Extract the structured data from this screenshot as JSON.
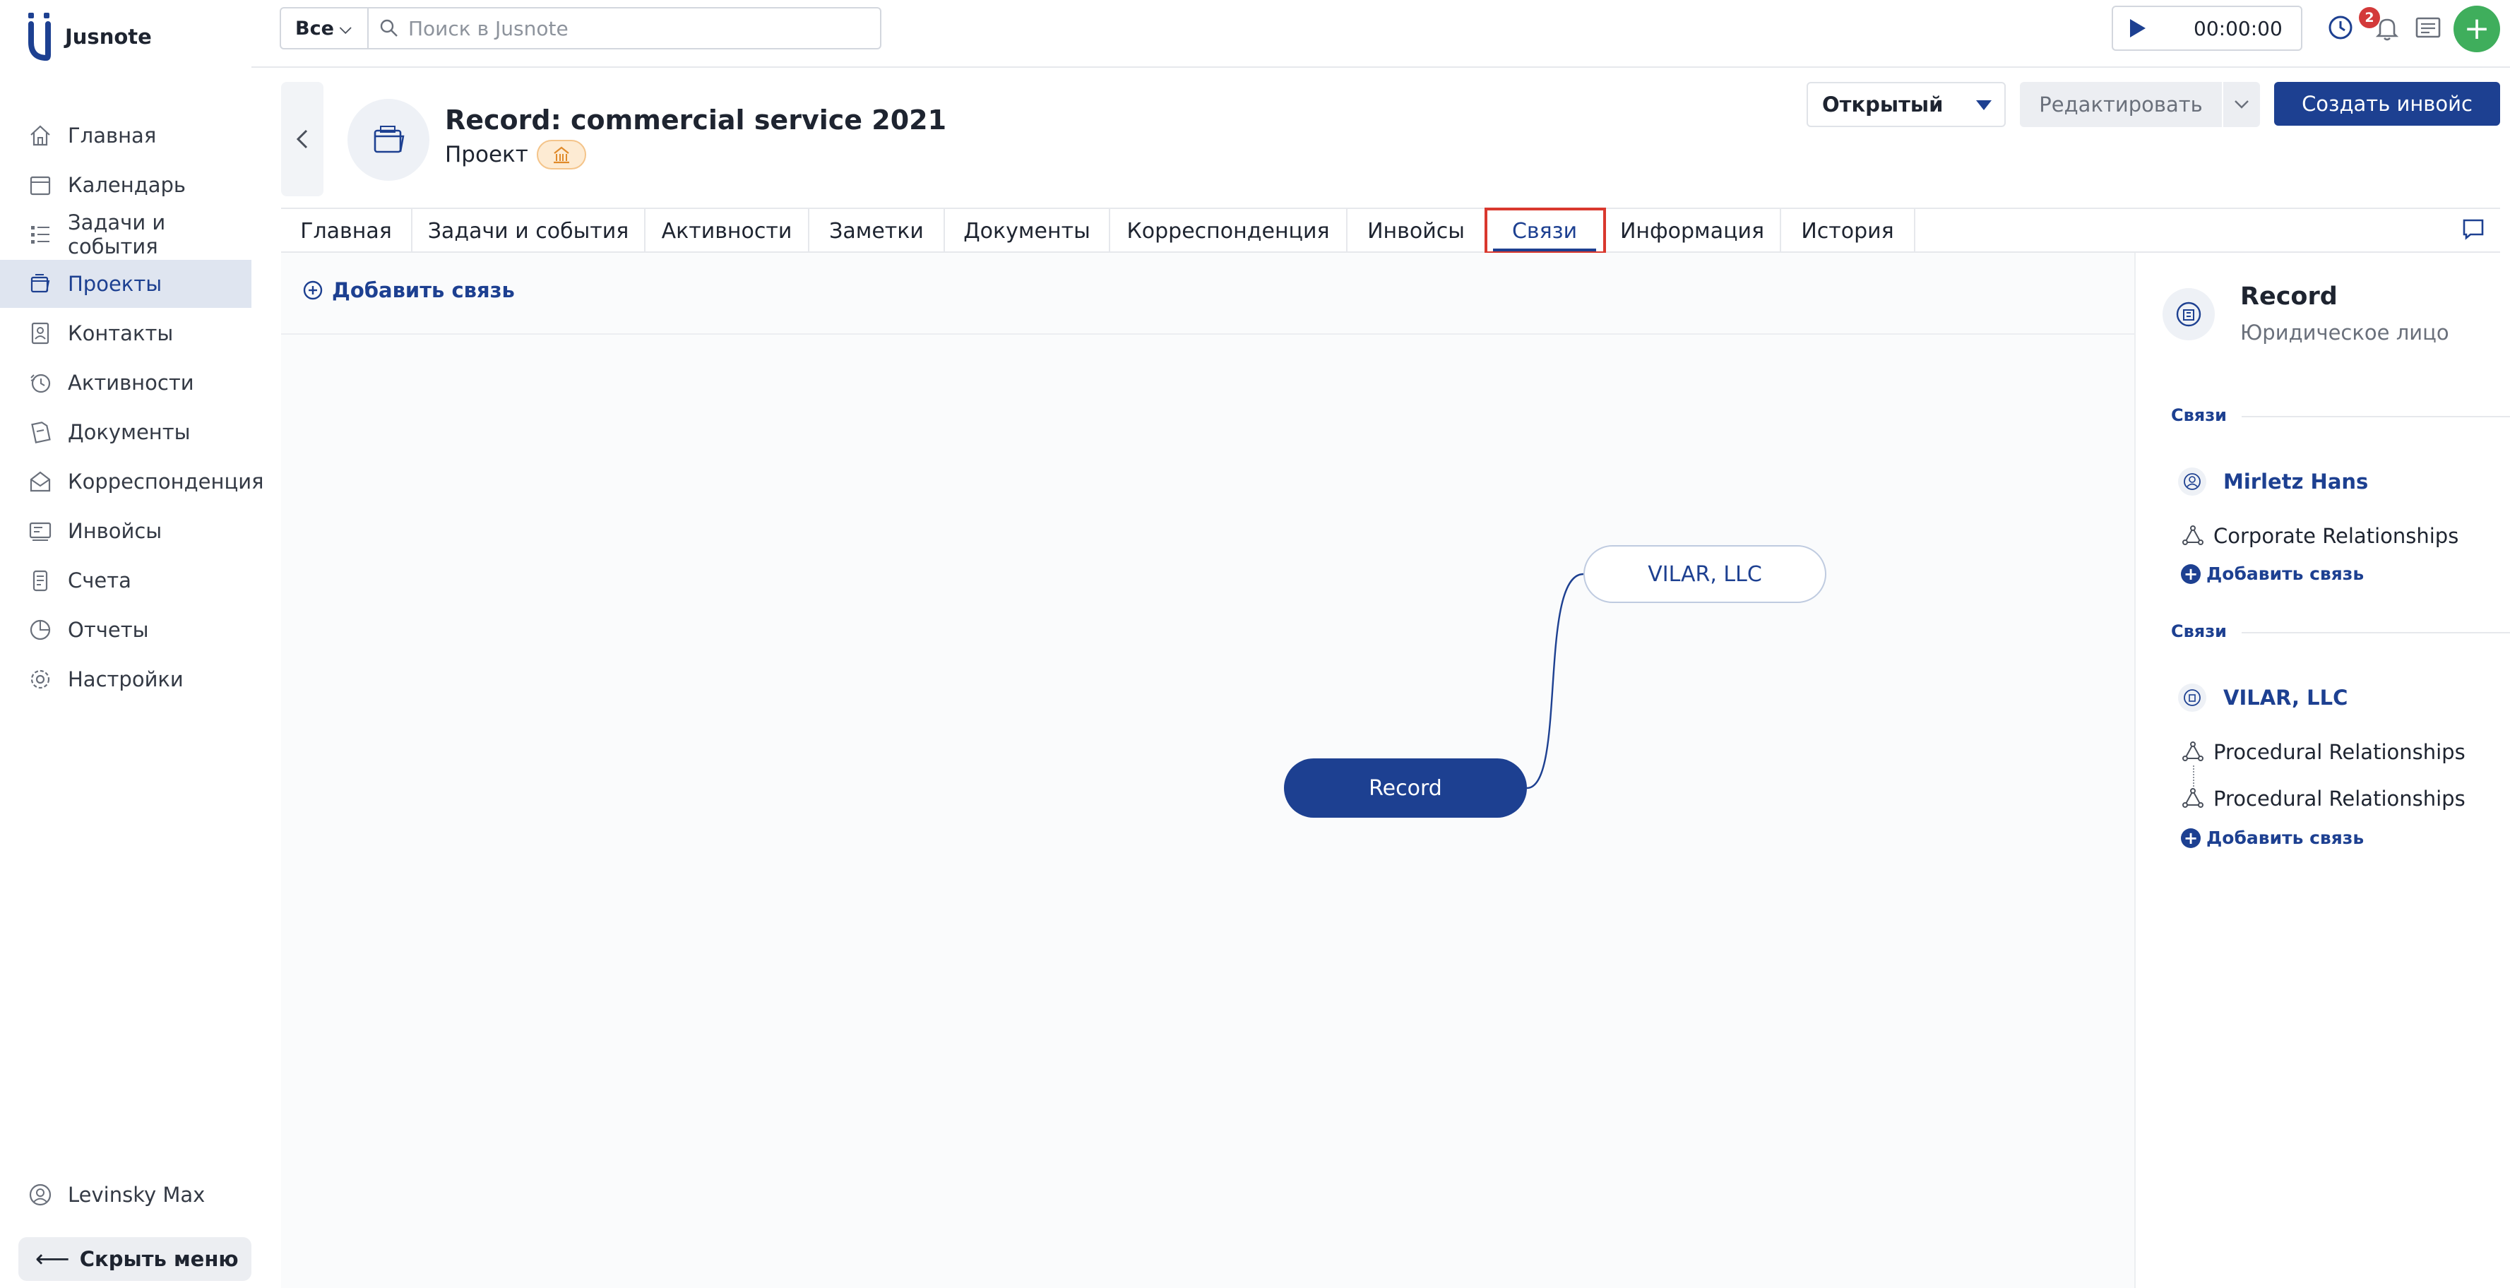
{
  "app": {
    "name": "Jusnote",
    "accent": "#1d4091",
    "highlight": "#d9382e"
  },
  "sidebar": {
    "items": [
      {
        "label": "Главная",
        "icon": "home-icon"
      },
      {
        "label": "Календарь",
        "icon": "calendar-icon"
      },
      {
        "label": "Задачи и события",
        "icon": "tasks-icon"
      },
      {
        "label": "Проекты",
        "icon": "projects-icon",
        "active": true
      },
      {
        "label": "Контакты",
        "icon": "contacts-icon"
      },
      {
        "label": "Активности",
        "icon": "activity-icon"
      },
      {
        "label": "Документы",
        "icon": "documents-icon"
      },
      {
        "label": "Корреспонденция",
        "icon": "correspondence-icon"
      },
      {
        "label": "Инвойсы",
        "icon": "invoices-icon"
      },
      {
        "label": "Счета",
        "icon": "accounts-icon"
      },
      {
        "label": "Отчеты",
        "icon": "reports-icon"
      },
      {
        "label": "Настройки",
        "icon": "settings-icon"
      }
    ],
    "user": "Levinsky Max",
    "hide_menu": "Скрыть меню"
  },
  "topbar": {
    "scope": "Все",
    "search_placeholder": "Поиск в Jusnote",
    "timer": "00:00:00",
    "notifications_count": "2"
  },
  "project": {
    "title": "Record: commercial service 2021",
    "type": "Проект",
    "status": "Открытый",
    "edit_label": "Редактировать",
    "invoice_label": "Создать инвойс"
  },
  "tabs": [
    {
      "label": "Главная"
    },
    {
      "label": "Задачи и события"
    },
    {
      "label": "Активности"
    },
    {
      "label": "Заметки"
    },
    {
      "label": "Документы"
    },
    {
      "label": "Корреспонденция"
    },
    {
      "label": "Инвойсы"
    },
    {
      "label": "Связи",
      "active": true
    },
    {
      "label": "Информация"
    },
    {
      "label": "История"
    }
  ],
  "canvas": {
    "add_link": "Добавить связь",
    "root_node": "Record",
    "child_node": "VILAR, LLC"
  },
  "panel": {
    "name": "Record",
    "subtitle": "Юридическое лицо",
    "groups": [
      {
        "section": "Связи",
        "entity": "Mirletz Hans",
        "entity_icon": "person-icon",
        "relations": [
          "Corporate Relationships"
        ],
        "add_label": "Добавить связь"
      },
      {
        "section": "Связи",
        "entity": "VILAR, LLC",
        "entity_icon": "company-icon",
        "relations": [
          "Procedural Relationships",
          "Procedural Relationships"
        ],
        "add_label": "Добавить связь"
      }
    ]
  }
}
